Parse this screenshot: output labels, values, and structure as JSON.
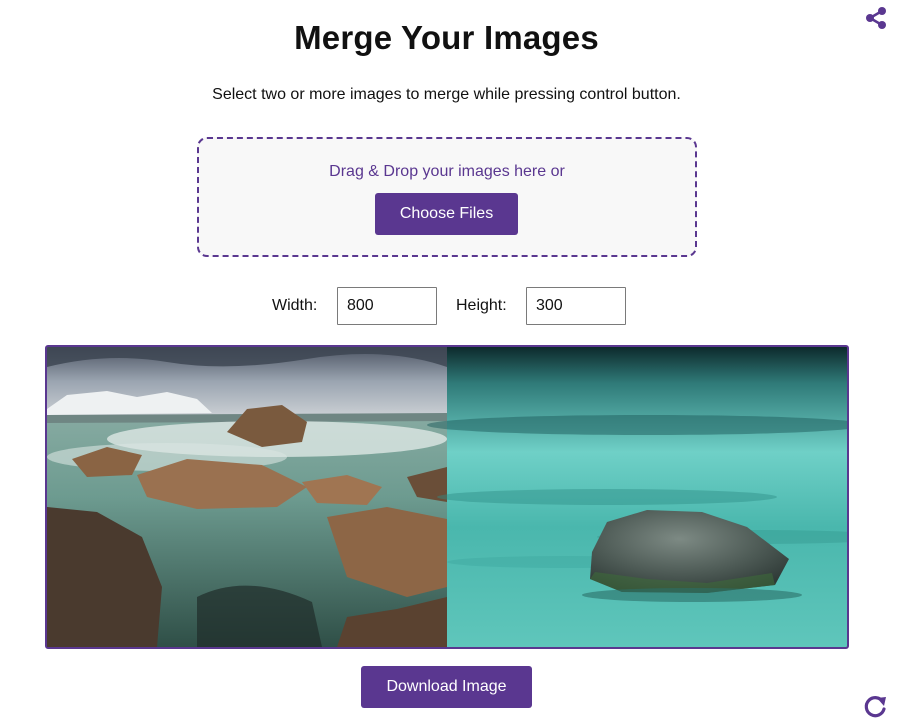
{
  "header": {
    "title": "Merge Your Images",
    "subtitle": "Select two or more images to merge while pressing control button."
  },
  "dropzone": {
    "text": "Drag & Drop your images here or",
    "choose_label": "Choose Files"
  },
  "dimensions": {
    "width_label": "Width:",
    "width_value": "800",
    "height_label": "Height:",
    "height_value": "300"
  },
  "preview": {
    "images": [
      {
        "name": "coastal-rocks-photo"
      },
      {
        "name": "rock-on-ice-photo"
      }
    ]
  },
  "actions": {
    "download_label": "Download Image"
  },
  "icons": {
    "share": "share-icon",
    "refresh": "refresh-icon"
  },
  "colors": {
    "accent": "#5a3790",
    "dropzone_bg": "#f8f8f8"
  }
}
